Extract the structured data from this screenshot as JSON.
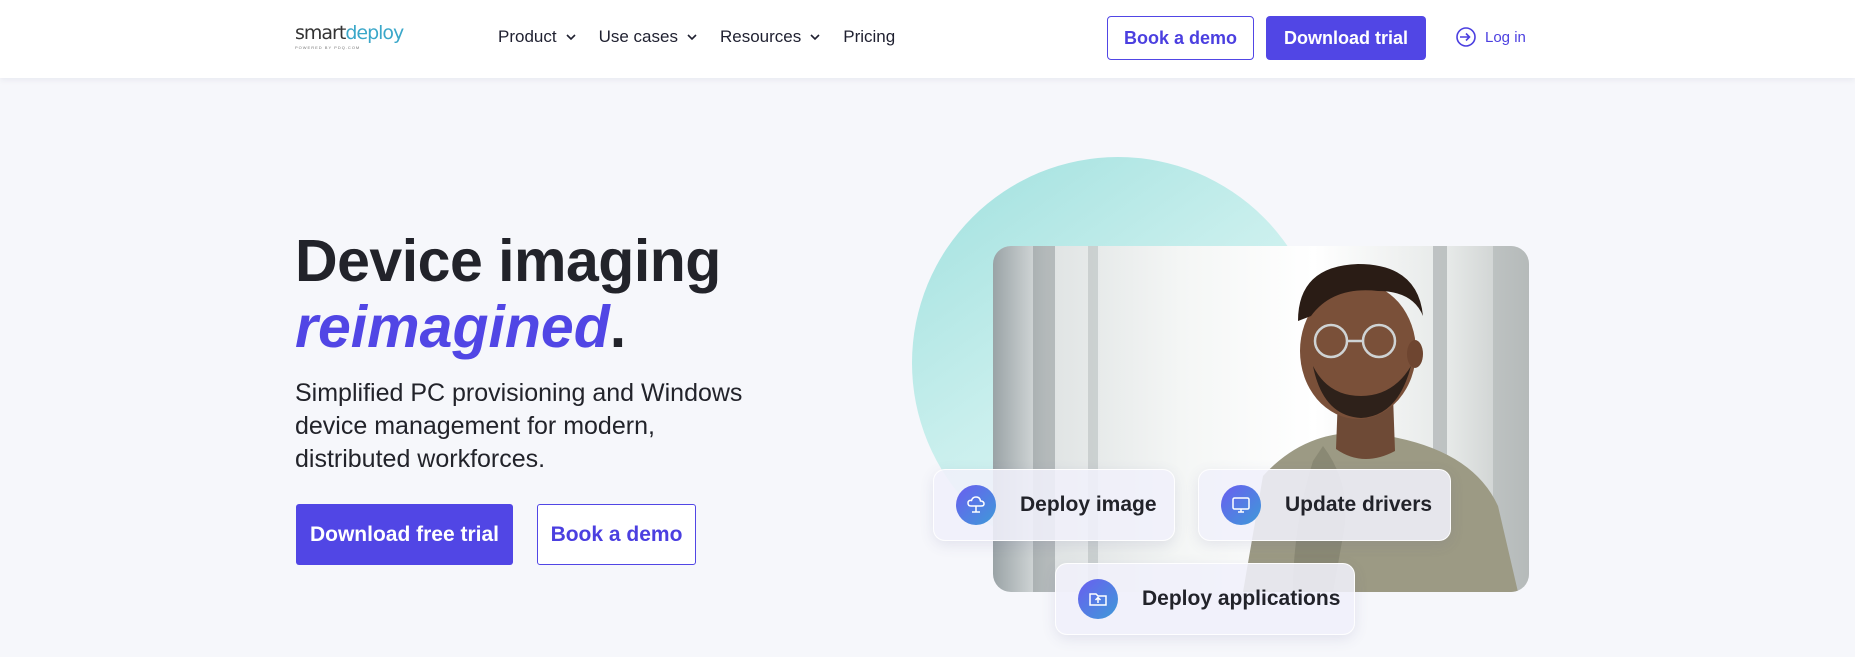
{
  "header": {
    "logo_text_main": "smart",
    "logo_text_accent": "deploy",
    "logo_subtext": "POWERED BY PDQ.COM",
    "nav": [
      {
        "label": "Product",
        "icon": "chevron-down-icon"
      },
      {
        "label": "Use cases",
        "icon": "chevron-down-icon"
      },
      {
        "label": "Resources",
        "icon": "chevron-down-icon"
      },
      {
        "label": "Pricing"
      }
    ],
    "book_demo_label": "Book a demo",
    "download_trial_label": "Download trial",
    "login_label": "Log in",
    "login_icon": "login-arrow-icon"
  },
  "hero": {
    "title_line1": "Device imaging",
    "title_accent": "reimagined",
    "title_end": ".",
    "subtitle": "Simplified PC provisioning and Windows device management for modern, distributed workforces.",
    "primary_cta": "Download free trial",
    "secondary_cta": "Book a demo",
    "chips": [
      {
        "label": "Deploy image",
        "icon": "cloud-deploy-icon"
      },
      {
        "label": "Update drivers",
        "icon": "monitor-icon"
      },
      {
        "label": "Deploy applications",
        "icon": "folder-upload-icon"
      }
    ]
  },
  "colors": {
    "brand": "#5146e5",
    "text": "#22232a",
    "background": "#f6f7fb",
    "circle_accent": "#9fe0de"
  }
}
